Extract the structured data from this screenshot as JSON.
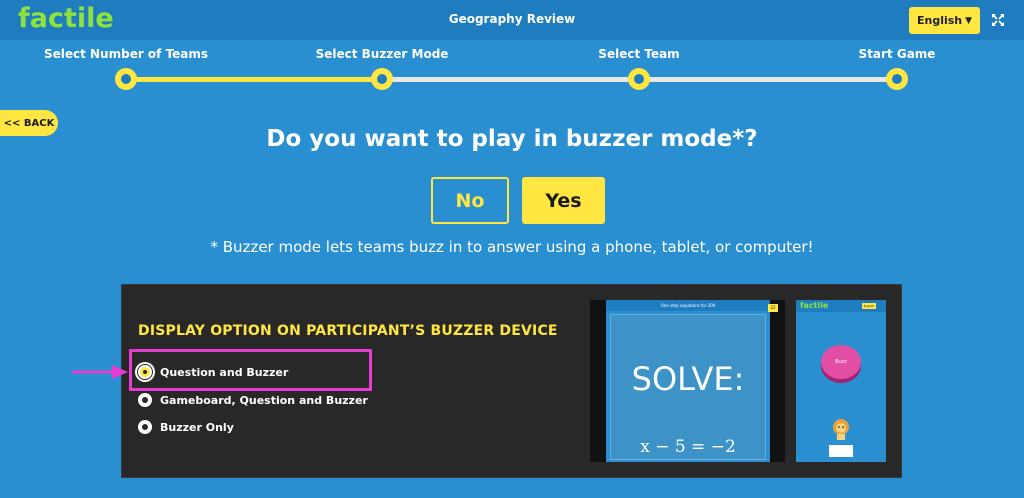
{
  "header": {
    "logo": "factile",
    "title": "Geography Review",
    "language": "English"
  },
  "steps": [
    {
      "label": "Select Number of Teams"
    },
    {
      "label": "Select Buzzer Mode"
    },
    {
      "label": "Select Team"
    },
    {
      "label": "Start Game"
    }
  ],
  "current_step": 2,
  "back_label": "<< BACK",
  "question": "Do you want to play in buzzer mode*?",
  "choices": {
    "no": "No",
    "yes": "Yes"
  },
  "footnote": "* Buzzer mode lets teams buzz in to answer using a phone, tablet, or computer!",
  "display_panel": {
    "title": "DISPLAY OPTION ON PARTICIPANT’S BUZZER DEVICE",
    "options": [
      {
        "label": "Question and Buzzer",
        "selected": true
      },
      {
        "label": "Gameboard, Question and Buzzer",
        "selected": false
      },
      {
        "label": "Buzzer Only",
        "selected": false
      }
    ]
  },
  "preview": {
    "header": "One step equations for 200",
    "score": "22",
    "solve": "SOLVE:",
    "equation": "x − 5 = −2",
    "buzzer_logo": "factile",
    "buzzer_lang": "English",
    "buzz": "Buzz"
  },
  "colors": {
    "background": "#2a8fd0",
    "topbar": "#1f7dbf",
    "accent": "#ffe640",
    "logo": "#8fe23d",
    "highlight": "#e63bd0",
    "panel": "#282828"
  }
}
